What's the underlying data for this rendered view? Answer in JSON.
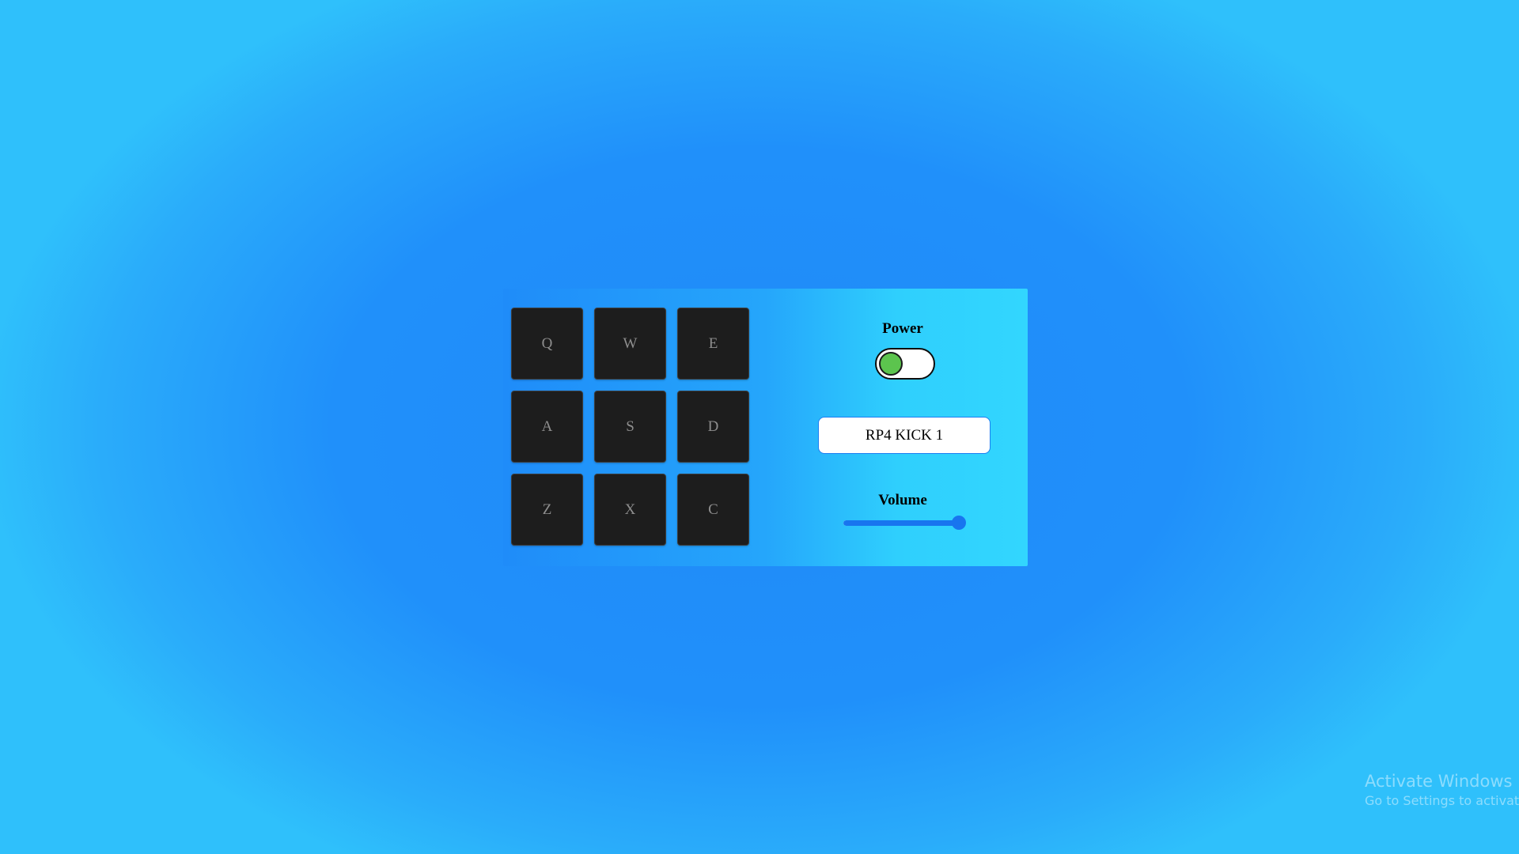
{
  "pads": [
    {
      "key": "Q"
    },
    {
      "key": "W"
    },
    {
      "key": "E"
    },
    {
      "key": "A"
    },
    {
      "key": "S"
    },
    {
      "key": "D"
    },
    {
      "key": "Z"
    },
    {
      "key": "X"
    },
    {
      "key": "C"
    }
  ],
  "power": {
    "label": "Power",
    "on": true,
    "knob_color": "#5cc44e"
  },
  "display": {
    "text": "RP4 KICK 1"
  },
  "volume": {
    "label": "Volume",
    "value": 0.95
  },
  "watermark": {
    "title": "Activate Windows",
    "subtitle": "Go to Settings to activate"
  },
  "colors": {
    "pad_bg": "#1d1d1d",
    "slider_accent": "#1875ef"
  }
}
